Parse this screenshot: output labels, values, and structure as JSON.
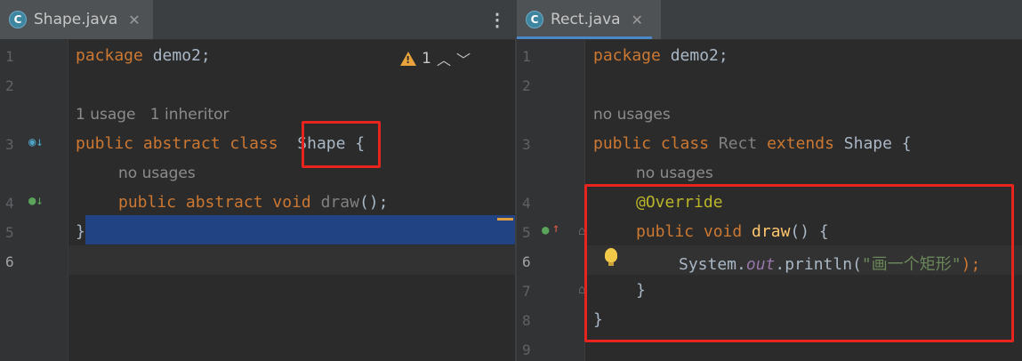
{
  "left": {
    "tab": {
      "label": "Shape.java",
      "close": "✕",
      "icon_letter": "C"
    },
    "menu_icon": "⋮",
    "warning": {
      "count": "1"
    },
    "lines": {
      "n1": "1",
      "n2": "2",
      "n3": "3",
      "n4": "4",
      "n5": "5",
      "n6": "6",
      "l1_kw": "package",
      "l1_rest": " demo2;",
      "hint1": "1 usage",
      "hint2": "1 inheritor",
      "l3_kw": "public abstract class",
      "l3_name": "Shape",
      "l3_brace": " {",
      "hint3": "no usages",
      "l4_kw": "public abstract void",
      "l4_name": " draw",
      "l4_rest": "();",
      "l5": "}"
    }
  },
  "right": {
    "tab": {
      "label": "Rect.java",
      "close": "✕",
      "icon_letter": "C"
    },
    "lines": {
      "n1": "1",
      "n2": "2",
      "n3": "3",
      "n4": "4",
      "n5": "5",
      "n6": "6",
      "n7": "7",
      "n8": "8",
      "n9": "9",
      "l1_kw": "package",
      "l1_rest": " demo2;",
      "hint1": "no usages",
      "l3_kw1": "public class",
      "l3_name": " Rect",
      "l3_kw2": " extends",
      "l3_rest": " Shape {",
      "hint2": "no usages",
      "l4_ann": "@Override",
      "l5_kw": "public void",
      "l5_name": " draw",
      "l5_rest": "() {",
      "l6_a": "System.",
      "l6_field": "out",
      "l6_b": ".println(",
      "l6_str": "\"画一个矩形\"",
      "l6_c": ");",
      "l7": "}",
      "l8": "}"
    }
  },
  "colors": {
    "keyword": "#cc7832",
    "string": "#6a8759",
    "annotation": "#bbb529",
    "highlight_box": "#e8241f"
  }
}
